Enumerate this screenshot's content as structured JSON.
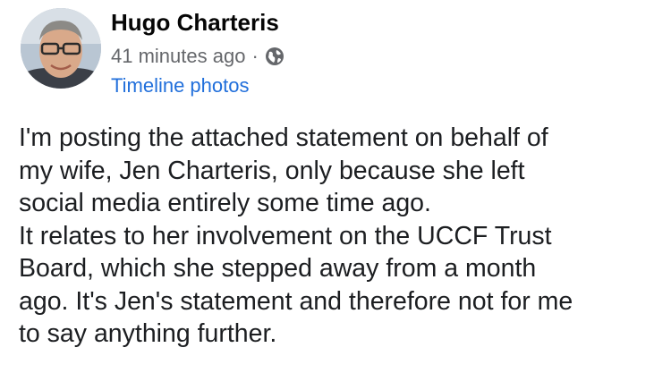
{
  "post": {
    "author": "Hugo Charteris",
    "timestamp": "41 minutes ago",
    "separator": "·",
    "privacy_icon": "globe-icon",
    "album_link": "Timeline photos",
    "body_lines": [
      "I'm posting the attached statement on behalf of",
      "my wife, Jen Charteris, only because she left",
      "social media entirely some time ago.",
      "It relates to her involvement on the UCCF Trust",
      "Board, which she stepped away from a month",
      "ago. It's Jen's statement and therefore not for me",
      "to say anything further."
    ]
  },
  "colors": {
    "author": "#050505",
    "meta": "#65676b",
    "link": "#216fdb",
    "body": "#1c1e21"
  }
}
